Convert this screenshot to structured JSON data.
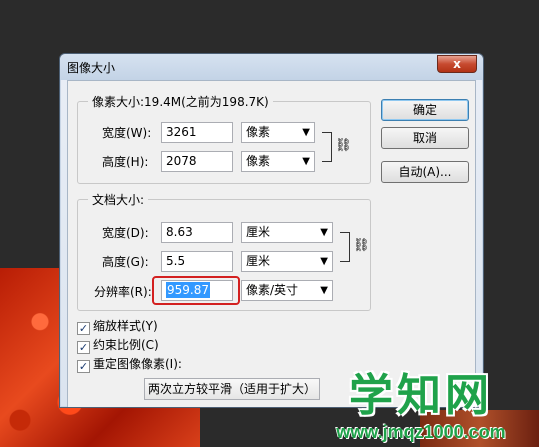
{
  "window": {
    "title": "图像大小",
    "close_glyph": "x"
  },
  "pixel_dimensions": {
    "title": "像素大小:19.4M(之前为198.7K)",
    "width_label": "宽度(W):",
    "width_value": "3261",
    "width_unit": "像素",
    "height_label": "高度(H):",
    "height_value": "2078",
    "height_unit": "像素"
  },
  "document_size": {
    "title": "文档大小:",
    "width_label": "宽度(D):",
    "width_value": "8.63",
    "width_unit": "厘米",
    "height_label": "高度(G):",
    "height_value": "5.5",
    "height_unit": "厘米",
    "resolution_label": "分辨率(R):",
    "resolution_value": "959.87",
    "resolution_unit": "像素/英寸"
  },
  "buttons": {
    "ok": "确定",
    "cancel": "取消",
    "auto": "自动(A)..."
  },
  "options": {
    "scale_styles": "缩放样式(Y)",
    "constrain_proportions": "约束比例(C)",
    "resample_image": "重定图像像素(I):",
    "resample_method": "两次立方较平滑（适用于扩大）"
  },
  "icons": {
    "check": "✓",
    "dropdown": "▼",
    "chain": "⛓"
  },
  "watermark": {
    "title": "学知网",
    "url": "www.jmqz1000.com"
  },
  "colors": {
    "accent_highlight": "#d32020",
    "watermark": "#1fa24a"
  }
}
